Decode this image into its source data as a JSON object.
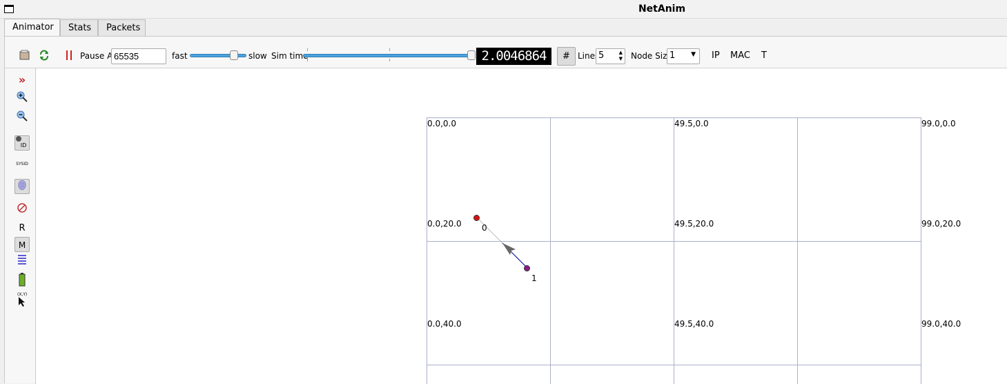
{
  "window": {
    "title": "NetAnim"
  },
  "tabs": [
    {
      "label": "Animator",
      "active": true
    },
    {
      "label": "Stats",
      "active": false
    },
    {
      "label": "Packets",
      "active": false
    }
  ],
  "toolbar": {
    "pause_at_label": "Pause At",
    "pause_at_value": "65535",
    "fast_label": "fast",
    "slow_label": "slow",
    "speed_value": 0.78,
    "sim_time_label": "Sim time",
    "sim_time_value": 1.0,
    "lcd_value": "2.0046864",
    "lines_label": "Lines",
    "lines_value": "5",
    "node_size_label": "Node Size",
    "node_size_value": "1",
    "ip_label": "IP",
    "mac_label": "MAC",
    "t_label": "T"
  },
  "sidebar": {
    "r_label": "R",
    "m_label": "M",
    "sysid_label": "SYSID",
    "id_label": "ID",
    "xy_label": "(X,Y)"
  },
  "grid": {
    "labels": [
      "0.0,0.0",
      "49.5,0.0",
      "99.0,0.0",
      "0.0,20.0",
      "49.5,20.0",
      "99.0,20.0",
      "0.0,40.0",
      "49.5,40.0",
      "99.0,40.0"
    ]
  },
  "nodes": [
    {
      "id": "0",
      "color": "#e01010"
    },
    {
      "id": "1",
      "color": "#8b1a8b"
    }
  ],
  "colors": {
    "accent": "#4aa3df",
    "grid": "#aab0c8",
    "packet_line": "#1a1ab0"
  }
}
